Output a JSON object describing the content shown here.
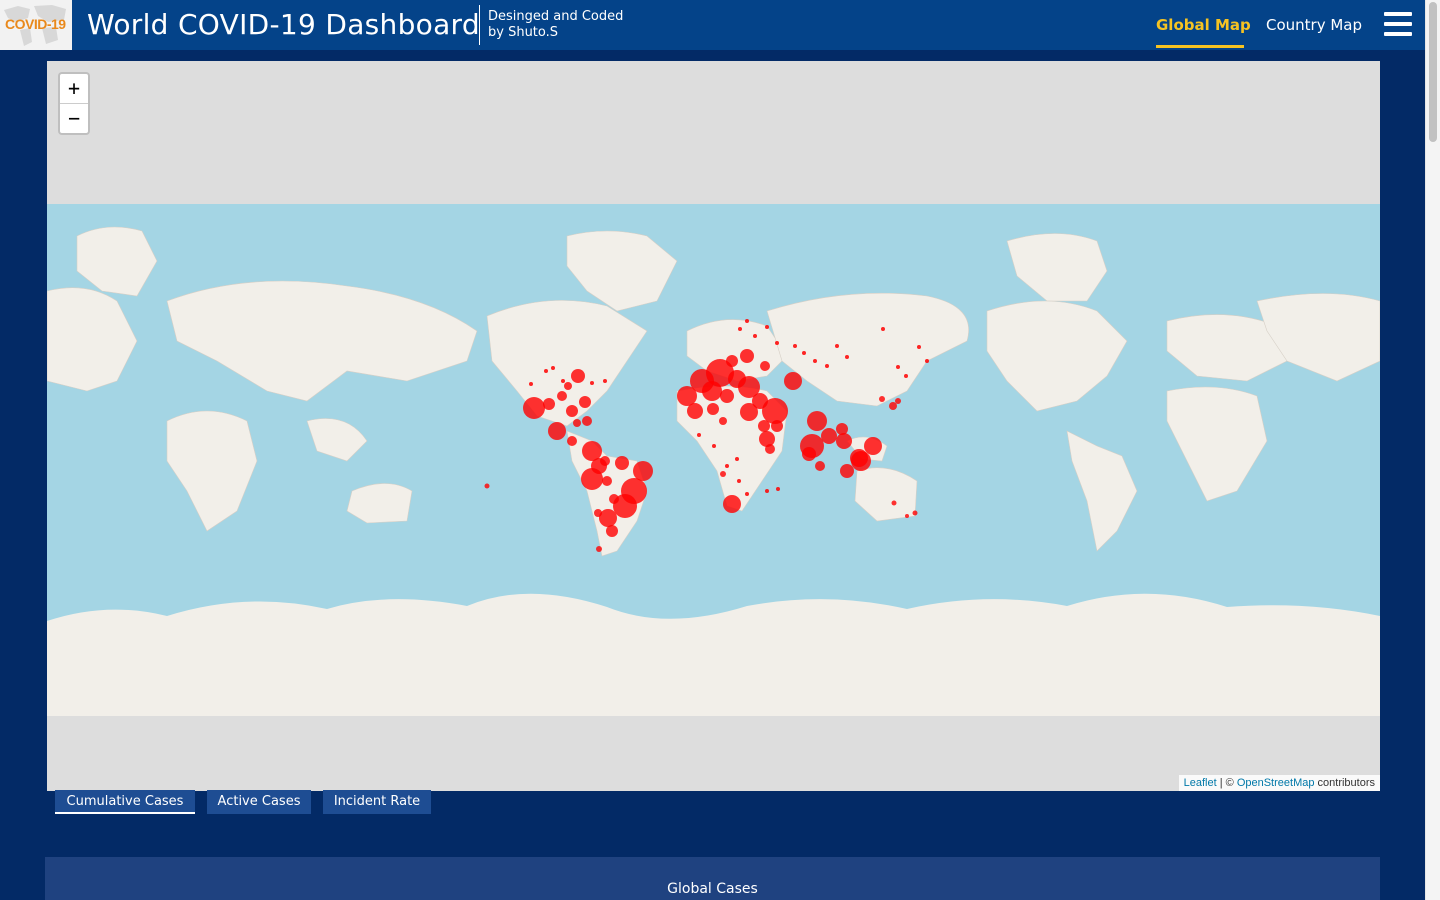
{
  "header": {
    "logo_text": "COVID-19",
    "title": "World COVID-19 Dashboard",
    "credit_line1": "Desinged and Coded",
    "credit_line2": "by Shuto.S",
    "nav": {
      "global_map": "Global Map",
      "country_map": "Country Map"
    },
    "menu_icon": "hamburger-icon",
    "accent_color": "#f6c322"
  },
  "map": {
    "zoom_in": "+",
    "zoom_out": "−",
    "attribution": {
      "leaflet": "Leaflet",
      "separator": " | © ",
      "osm": "OpenStreetMap",
      "suffix": " contributors"
    },
    "marker_color": "#ff0000",
    "ocean_color": "#a4d5e4",
    "land_color": "#f2efe9"
  },
  "layer_tabs": {
    "cumulative": "Cumulative Cases",
    "active": "Active Cases",
    "incident": "Incident Rate",
    "selected": "Cumulative Cases"
  },
  "summary": {
    "global_cases_title": "Global Cases"
  }
}
